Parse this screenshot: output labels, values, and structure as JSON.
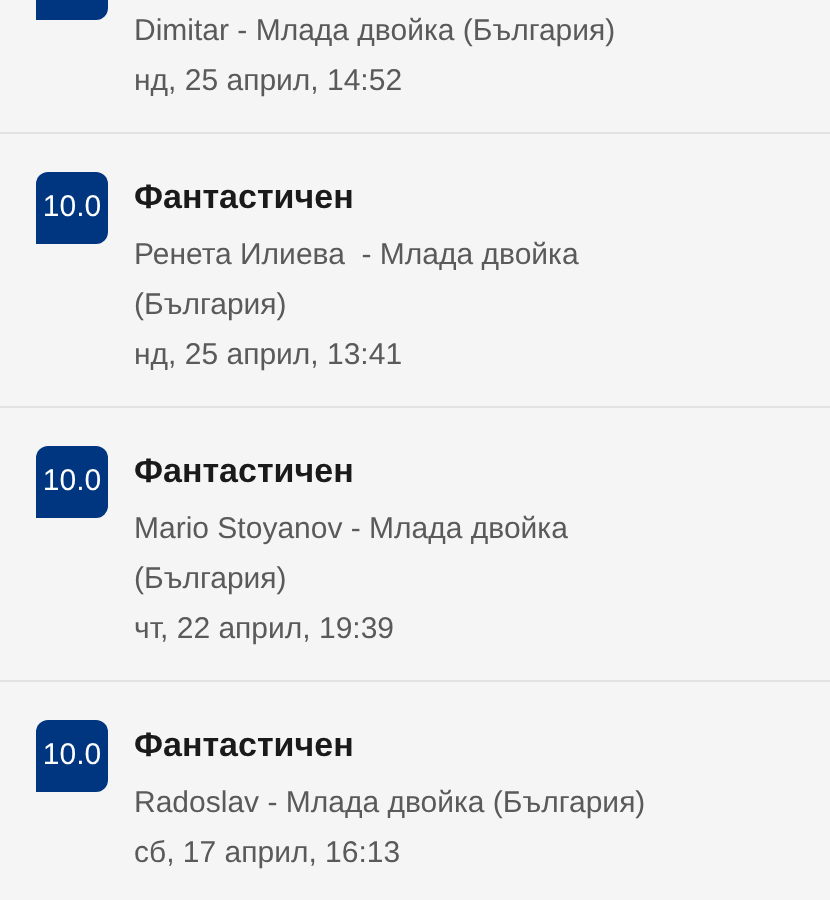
{
  "reviews": [
    {
      "reviewer": "Dimitar - Млада двойка (България)",
      "date": "нд, 25 април, 14:52"
    },
    {
      "score": "10.0",
      "title": "Фантастичен",
      "reviewer": "Ренета Илиева  - Млада двойка (България)",
      "date": "нд, 25 април, 13:41"
    },
    {
      "score": "10.0",
      "title": "Фантастичен",
      "reviewer": "Mario Stoyanov - Млада двойка (България)",
      "date": "чт, 22 април, 19:39"
    },
    {
      "score": "10.0",
      "title": "Фантастичен",
      "reviewer": "Radoslav - Млада двойка (България)",
      "date": "сб, 17 април, 16:13"
    }
  ]
}
